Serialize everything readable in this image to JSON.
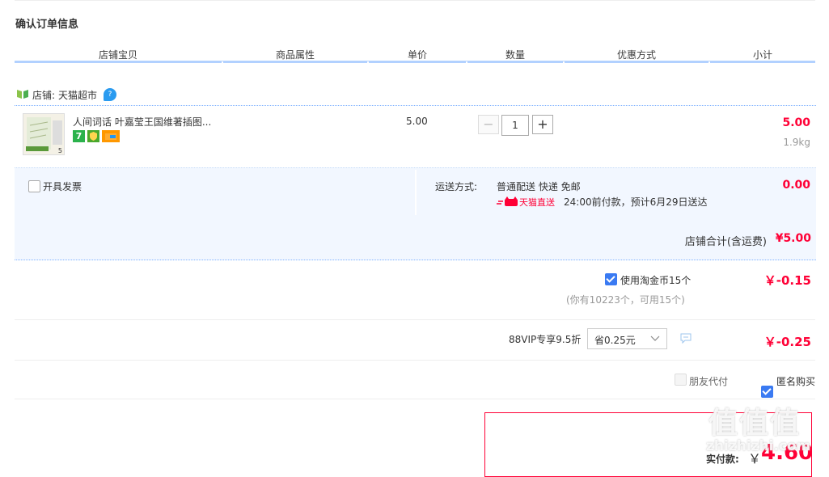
{
  "page": {
    "title": "确认订单信息"
  },
  "columns": [
    "店铺宝贝",
    "商品属性",
    "单价",
    "数量",
    "优惠方式",
    "小计"
  ],
  "shop": {
    "label": "店铺:",
    "name": "天猫超市",
    "badge": "?"
  },
  "item": {
    "name": "人间词话 叶嘉莹王国维著插图...",
    "tag_seven": "7",
    "thumb_number": "5",
    "unit_price": "5.00",
    "quantity": "1",
    "minus": "−",
    "plus": "+",
    "subtotal": "5.00",
    "weight": "1.9kg"
  },
  "invoice": {
    "label": "开具发票"
  },
  "shipping": {
    "label": "运送方式:",
    "method": "普通配送 快递 免邮",
    "brand": "天猫直送",
    "eta": "24:00前付款，预计6月29日送达",
    "fee": "0.00"
  },
  "shop_total": {
    "label": "店铺合计(含运费)",
    "value": "¥5.00"
  },
  "coins": {
    "label": "使用淘金币15个",
    "note": "(你有10223个，可用15个)",
    "value": "￥-0.15"
  },
  "vip": {
    "label": "88VIP专享9.5折",
    "select_value": "省0.25元",
    "value": "￥-0.25"
  },
  "options": {
    "friend_pay": "朋友代付",
    "anonymous": "匿名购买"
  },
  "order": {
    "label": "实付款:",
    "currency": "￥",
    "amount": "4.60"
  },
  "watermark": {
    "text": "值值值",
    "domain": "zhizhizhi.com"
  },
  "colors": {
    "accent": "#ff0036",
    "blue": "#3a7af2",
    "header_bar": "#b2d1ff",
    "panel_bg": "#f2f7ff"
  }
}
